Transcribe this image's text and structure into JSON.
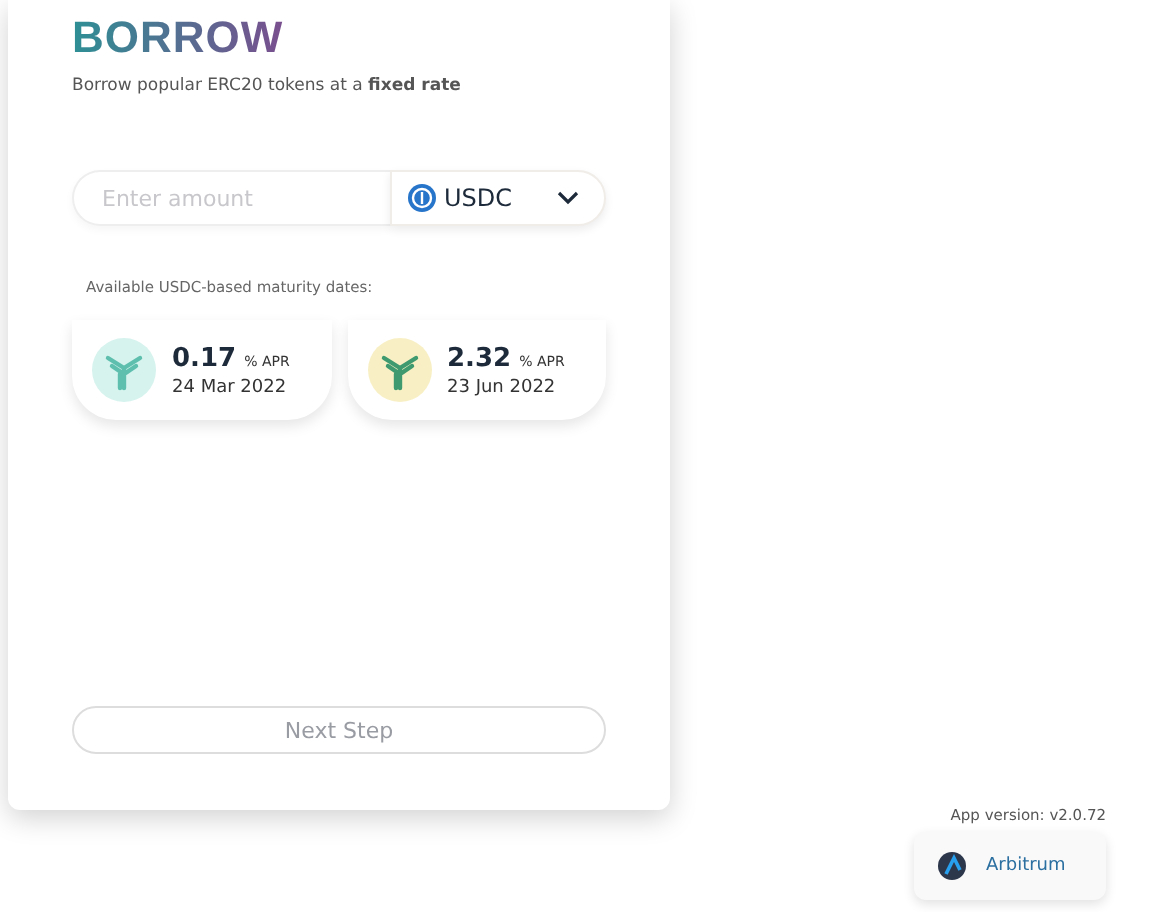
{
  "title": "BORROW",
  "subtitle": "Borrow popular ERC20 tokens at a **fixed rate**",
  "amount": {
    "placeholder": "Enter amount"
  },
  "token": {
    "label": "USDC"
  },
  "maturities_label": "Available USDC-based maturity dates:",
  "maturities": [
    {
      "rate": "0.17",
      "unit": "% APR",
      "date": "24 Mar 2022",
      "color": "#d6f3ee"
    },
    {
      "rate": "2.32",
      "unit": "% APR",
      "date": "23 Jun 2022",
      "color": "#f8f0c4"
    }
  ],
  "next_button": {
    "label": "Next Step",
    "disabled": true
  },
  "app_version": "App version: v2.0.72",
  "network": {
    "label": "Arbitrum"
  }
}
